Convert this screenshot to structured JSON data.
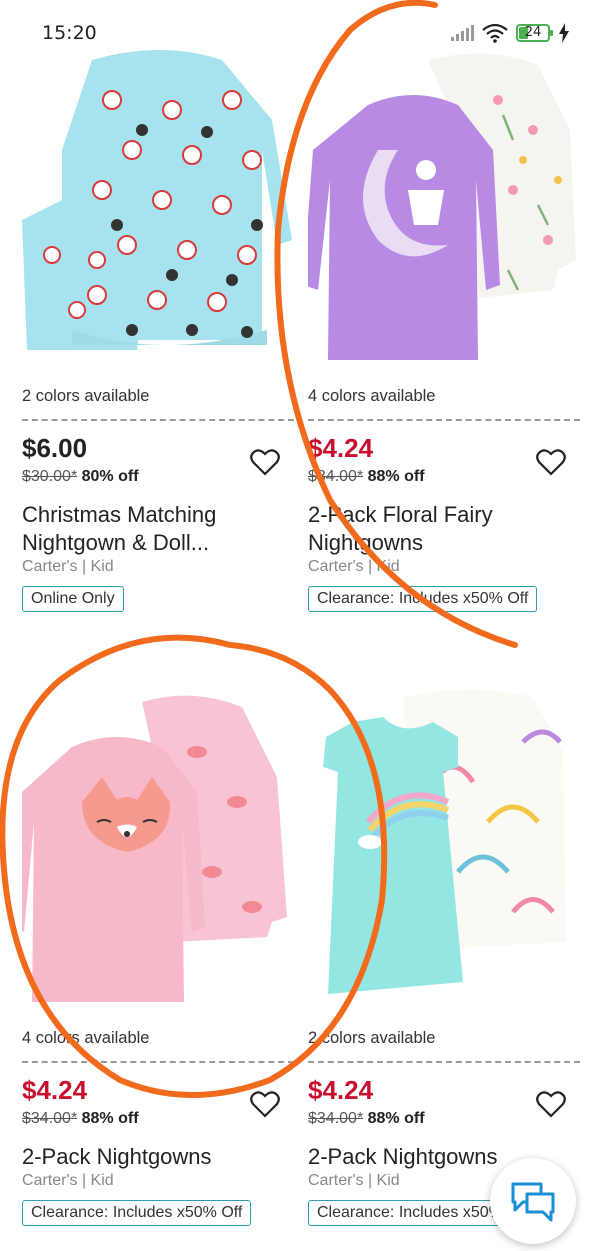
{
  "status_bar": {
    "time": "15:20",
    "battery_level": "24",
    "icons": [
      "signal-icon",
      "wifi-icon",
      "battery-icon",
      "charging-icon"
    ]
  },
  "products": [
    {
      "colors_available": "2 colors available",
      "price": "$6.00",
      "price_color": "#222222",
      "was_price": "$30.00*",
      "discount": "80% off",
      "title_line1": "Christmas Matching",
      "title_line2": "Nightgown & Doll...",
      "brand": "Carter's | Kid",
      "badge": "Online Only"
    },
    {
      "colors_available": "4 colors available",
      "price": "$4.24",
      "price_color": "#c8102e",
      "was_price": "$34.00*",
      "discount": "88% off",
      "title_line1": "2-Pack Floral Fairy",
      "title_line2": "Nightgowns",
      "brand": "Carter's | Kid",
      "badge": "Clearance: Includes x50% Off"
    },
    {
      "colors_available": "4 colors available",
      "price": "$4.24",
      "price_color": "#c8102e",
      "was_price": "$34.00*",
      "discount": "88% off",
      "title_line1": "2-Pack Nightgowns",
      "title_line2": "",
      "brand": "Carter's | Kid",
      "badge": "Clearance: Includes x50% Off"
    },
    {
      "colors_available": "2 colors available",
      "price": "$4.24",
      "price_color": "#c8102e",
      "was_price": "$34.00*",
      "discount": "88% off",
      "title_line1": "2-Pack Nightgowns",
      "title_line2": "",
      "brand": "Carter's | Kid",
      "badge": "Clearance: Includes x50% Off"
    }
  ],
  "chat_button": {
    "icon": "chat-bubbles-icon"
  },
  "colors": {
    "sale_red": "#c8102e",
    "badge_border": "#2a9fb2",
    "annotation_orange": "#f26b1d",
    "chat_blue": "#1a8fd6"
  }
}
